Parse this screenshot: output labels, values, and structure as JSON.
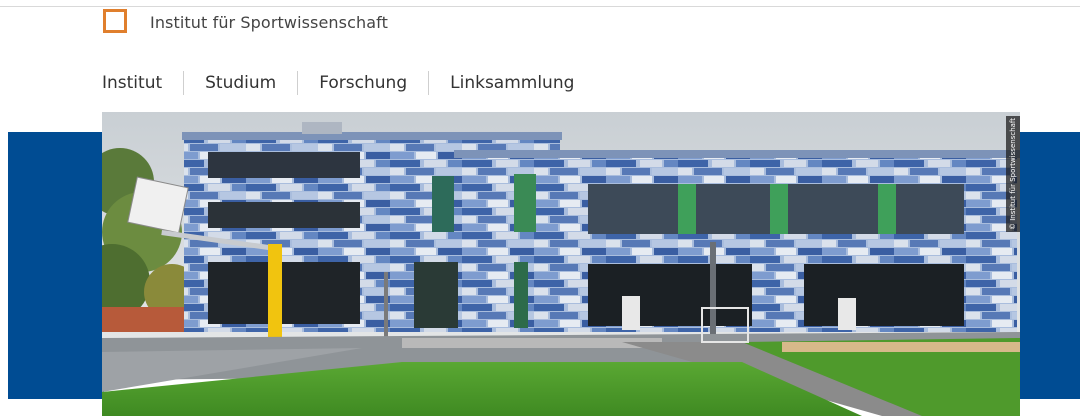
{
  "header": {
    "site_name": "Institut für Sportwissenschaft",
    "logo_color": "#e07f2d"
  },
  "nav": {
    "items": [
      {
        "label": "Institut"
      },
      {
        "label": "Studium"
      },
      {
        "label": "Forschung"
      },
      {
        "label": "Linksammlung"
      }
    ]
  },
  "hero": {
    "credit": "© Institut für Sportwissenschaft",
    "band_color": "#004c93"
  }
}
